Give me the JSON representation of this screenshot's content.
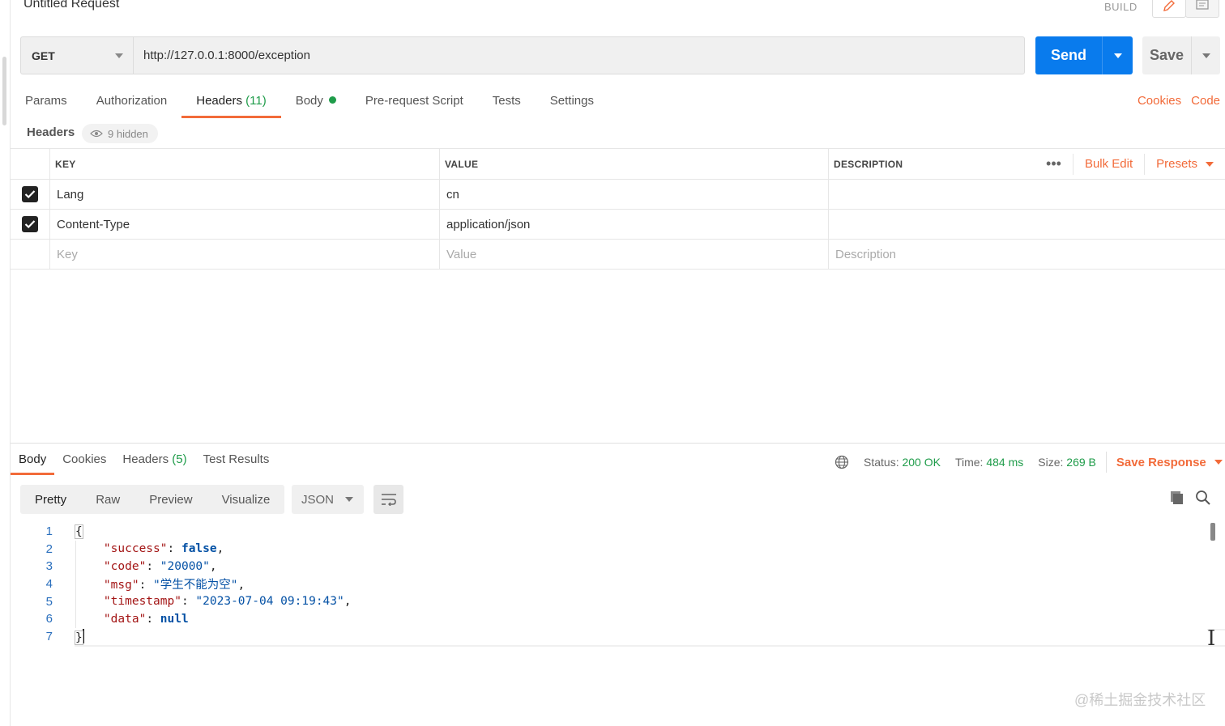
{
  "request": {
    "title": "Untitled Request",
    "build_label": "BUILD",
    "method": "GET",
    "url": "http://127.0.0.1:8000/exception",
    "send_label": "Send",
    "save_label": "Save"
  },
  "req_tabs": [
    {
      "label": "Params"
    },
    {
      "label": "Authorization"
    },
    {
      "label": "Headers",
      "count": "(11)"
    },
    {
      "label": "Body"
    },
    {
      "label": "Pre-request Script"
    },
    {
      "label": "Tests"
    },
    {
      "label": "Settings"
    }
  ],
  "right_links": {
    "cookies": "Cookies",
    "code": "Code"
  },
  "headers_section": {
    "label": "Headers",
    "hidden": "9 hidden",
    "columns": {
      "key": "KEY",
      "value": "VALUE",
      "description": "DESCRIPTION"
    },
    "bulk_edit": "Bulk Edit",
    "presets": "Presets",
    "more": "•••",
    "rows": [
      {
        "key": "Lang",
        "value": "cn",
        "description": ""
      },
      {
        "key": "Content-Type",
        "value": "application/json",
        "description": ""
      }
    ],
    "placeholders": {
      "key": "Key",
      "value": "Value",
      "description": "Description"
    }
  },
  "response": {
    "tabs": [
      {
        "label": "Body"
      },
      {
        "label": "Cookies"
      },
      {
        "label": "Headers",
        "count": "(5)"
      },
      {
        "label": "Test Results"
      }
    ],
    "status_label": "Status:",
    "status_value": "200 OK",
    "time_label": "Time:",
    "time_value": "484 ms",
    "size_label": "Size:",
    "size_value": "269 B",
    "save_response": "Save Response",
    "views": [
      "Pretty",
      "Raw",
      "Preview",
      "Visualize"
    ],
    "format": "JSON",
    "line_numbers": [
      "1",
      "2",
      "3",
      "4",
      "5",
      "6",
      "7"
    ],
    "body": {
      "open": "{",
      "close": "}",
      "success_key": "\"success\"",
      "success_val": "false",
      "code_key": "\"code\"",
      "code_val": "\"20000\"",
      "msg_key": "\"msg\"",
      "msg_val": "\"学生不能为空\"",
      "timestamp_key": "\"timestamp\"",
      "timestamp_val": "\"2023-07-04 09:19:43\"",
      "data_key": "\"data\"",
      "data_val": "null"
    }
  },
  "watermark": "@稀土掘金技术社区",
  "colors": {
    "accent": "#f26b3a",
    "send": "#097bed",
    "ok": "#1f9c4a",
    "string": "#0451a5",
    "key": "#a31515"
  }
}
